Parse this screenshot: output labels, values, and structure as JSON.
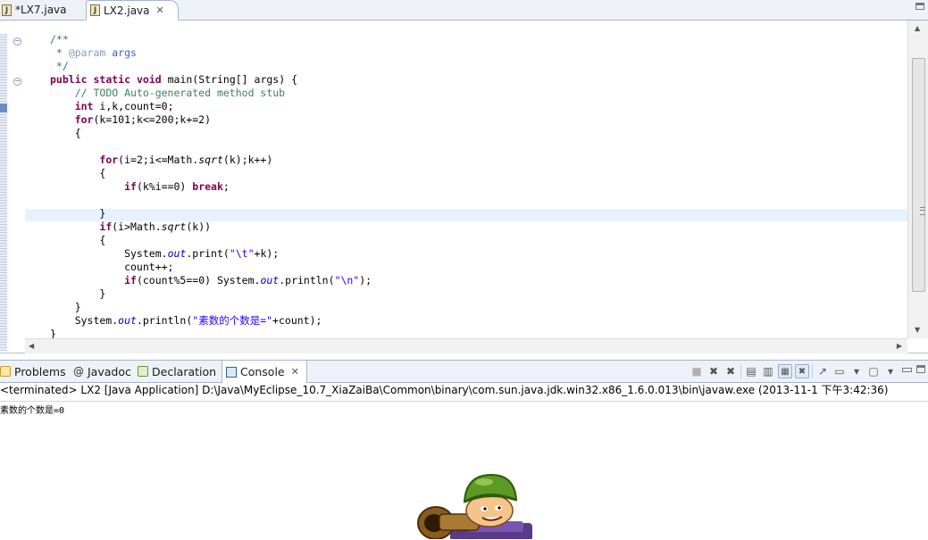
{
  "editor_tabs": [
    {
      "label": "*LX7.java",
      "icon": "java-file-icon"
    },
    {
      "label": "LX2.java",
      "icon": "java-file-icon",
      "active": true
    }
  ],
  "code_lines": [
    {
      "id": "l01",
      "tokens": [
        [
          "cm",
          "/**"
        ]
      ]
    },
    {
      "id": "l02",
      "tokens": [
        [
          "cm",
          " * "
        ],
        [
          "tg",
          "@param"
        ],
        [
          "cm",
          " args"
        ]
      ]
    },
    {
      "id": "l03",
      "tokens": [
        [
          "cm",
          " */"
        ]
      ]
    },
    {
      "id": "l04",
      "tokens": [
        [
          "kw",
          "public"
        ],
        [
          "",
          " "
        ],
        [
          "kw",
          "static"
        ],
        [
          "",
          " "
        ],
        [
          "kw",
          "void"
        ],
        [
          "",
          " main(String[] args) {"
        ]
      ]
    },
    {
      "id": "l05",
      "tokens": [
        [
          "",
          "    "
        ],
        [
          "lc",
          "// TODO Auto-generated method stub"
        ]
      ]
    },
    {
      "id": "l06",
      "tokens": [
        [
          "",
          "    "
        ],
        [
          "kw",
          "int"
        ],
        [
          "",
          " i,k,count=0;"
        ]
      ]
    },
    {
      "id": "l07",
      "tokens": [
        [
          "",
          "    "
        ],
        [
          "kw",
          "for"
        ],
        [
          "",
          "(k=101;k<=200;k+=2)"
        ]
      ]
    },
    {
      "id": "l08",
      "tokens": [
        [
          "",
          "    {"
        ]
      ]
    },
    {
      "id": "l09",
      "tokens": [
        [
          "",
          ""
        ]
      ]
    },
    {
      "id": "l10",
      "tokens": [
        [
          "",
          "        "
        ],
        [
          "kw",
          "for"
        ],
        [
          "",
          "(i=2;i<=Math."
        ],
        [
          "it",
          "sqrt"
        ],
        [
          "",
          "(k);k++)"
        ]
      ]
    },
    {
      "id": "l11",
      "tokens": [
        [
          "",
          "        {"
        ]
      ]
    },
    {
      "id": "l12",
      "tokens": [
        [
          "",
          "            "
        ],
        [
          "kw",
          "if"
        ],
        [
          "",
          "(k%i==0) "
        ],
        [
          "kw",
          "break"
        ],
        [
          "",
          ";"
        ]
      ]
    },
    {
      "id": "l13",
      "tokens": [
        [
          "",
          ""
        ]
      ]
    },
    {
      "id": "l14",
      "tokens": [
        [
          "",
          "        }"
        ]
      ]
    },
    {
      "id": "l15",
      "tokens": [
        [
          "",
          "        "
        ],
        [
          "kw",
          "if"
        ],
        [
          "",
          "(i>Math."
        ],
        [
          "it",
          "sqrt"
        ],
        [
          "",
          "(k))"
        ]
      ]
    },
    {
      "id": "l16",
      "tokens": [
        [
          "",
          "        {"
        ]
      ]
    },
    {
      "id": "l17",
      "tokens": [
        [
          "",
          "            System."
        ],
        [
          "fd",
          "out"
        ],
        [
          "",
          ".print("
        ],
        [
          "st",
          "\"\\t\""
        ],
        [
          "",
          "+k);"
        ]
      ]
    },
    {
      "id": "l18",
      "tokens": [
        [
          "",
          "            count++;"
        ]
      ]
    },
    {
      "id": "l19",
      "tokens": [
        [
          "",
          "            "
        ],
        [
          "kw",
          "if"
        ],
        [
          "",
          "(count%5==0) System."
        ],
        [
          "fd",
          "out"
        ],
        [
          "",
          ".println("
        ],
        [
          "st",
          "\"\\n\""
        ],
        [
          "",
          ");"
        ]
      ]
    },
    {
      "id": "l20",
      "tokens": [
        [
          "",
          "        }"
        ]
      ]
    },
    {
      "id": "l21",
      "tokens": [
        [
          "",
          "    }"
        ]
      ]
    },
    {
      "id": "l22",
      "tokens": [
        [
          "",
          "    System."
        ],
        [
          "fd",
          "out"
        ],
        [
          "",
          ".println("
        ],
        [
          "st",
          "\"素数的个数是=\""
        ],
        [
          "",
          "+count);"
        ]
      ]
    },
    {
      "id": "l23",
      "tokens": [
        [
          "",
          "}"
        ]
      ]
    }
  ],
  "view_tabs": [
    {
      "label": "Problems",
      "icon": "problems-icon"
    },
    {
      "label": "Javadoc",
      "icon": "at-sign-icon"
    },
    {
      "label": "Declaration",
      "icon": "declaration-icon"
    },
    {
      "label": "Console",
      "icon": "console-icon",
      "active": true
    }
  ],
  "console": {
    "status": "<terminated> LX2 [Java Application] D:\\Java\\MyEclipse_10.7_XiaZaiBa\\Common\\binary\\com.sun.java.jdk.win32.x86_1.6.0.013\\bin\\javaw.exe (2013-11-1 下午3:42:36)",
    "output": "素数的个数是=0"
  },
  "toolbar_icons": [
    "terminate-icon",
    "remove-launch-icon",
    "remove-all-terminated-icon",
    "scroll-lock-icon",
    "show-console-stdout-icon",
    "pin-console-icon",
    "show-console-stderr-icon",
    "open-console-icon",
    "display-selected-console-icon",
    "new-console-icon"
  ],
  "colors": {
    "keyword": "#7f0055",
    "comment": "#3f5fbf",
    "line_comment": "#3f7f5f",
    "string": "#2a00ff",
    "field": "#0000c0",
    "current_line": "#e8f2fe"
  }
}
